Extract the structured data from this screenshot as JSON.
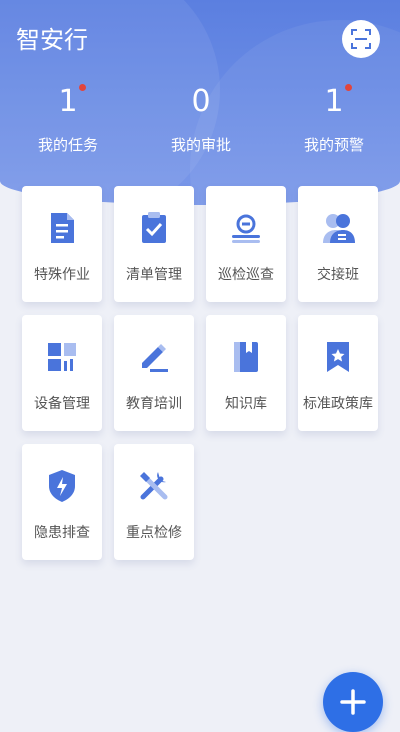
{
  "app": {
    "title": "智安行"
  },
  "stats": [
    {
      "value": "1",
      "label": "我的任务",
      "badge": true
    },
    {
      "value": "0",
      "label": "我的审批",
      "badge": false
    },
    {
      "value": "1",
      "label": "我的预警",
      "badge": true
    }
  ],
  "tiles": [
    {
      "label": "特殊作业",
      "icon": "document-icon"
    },
    {
      "label": "清单管理",
      "icon": "clipboard-check-icon"
    },
    {
      "label": "巡检巡查",
      "icon": "inspection-icon"
    },
    {
      "label": "交接班",
      "icon": "shift-handover-icon"
    },
    {
      "label": "设备管理",
      "icon": "equipment-grid-icon"
    },
    {
      "label": "教育培训",
      "icon": "pen-edit-icon"
    },
    {
      "label": "知识库",
      "icon": "book-icon"
    },
    {
      "label": "标准政策库",
      "icon": "bookmark-star-icon"
    },
    {
      "label": "隐患排查",
      "icon": "shield-bolt-icon"
    },
    {
      "label": "重点检修",
      "icon": "tools-icon"
    }
  ],
  "colors": {
    "header": "#5b7fe0",
    "accent": "#2e6fe6",
    "badge": "#e2453c",
    "icon": "#4a74db",
    "icon_light": "#a9bdf0"
  }
}
